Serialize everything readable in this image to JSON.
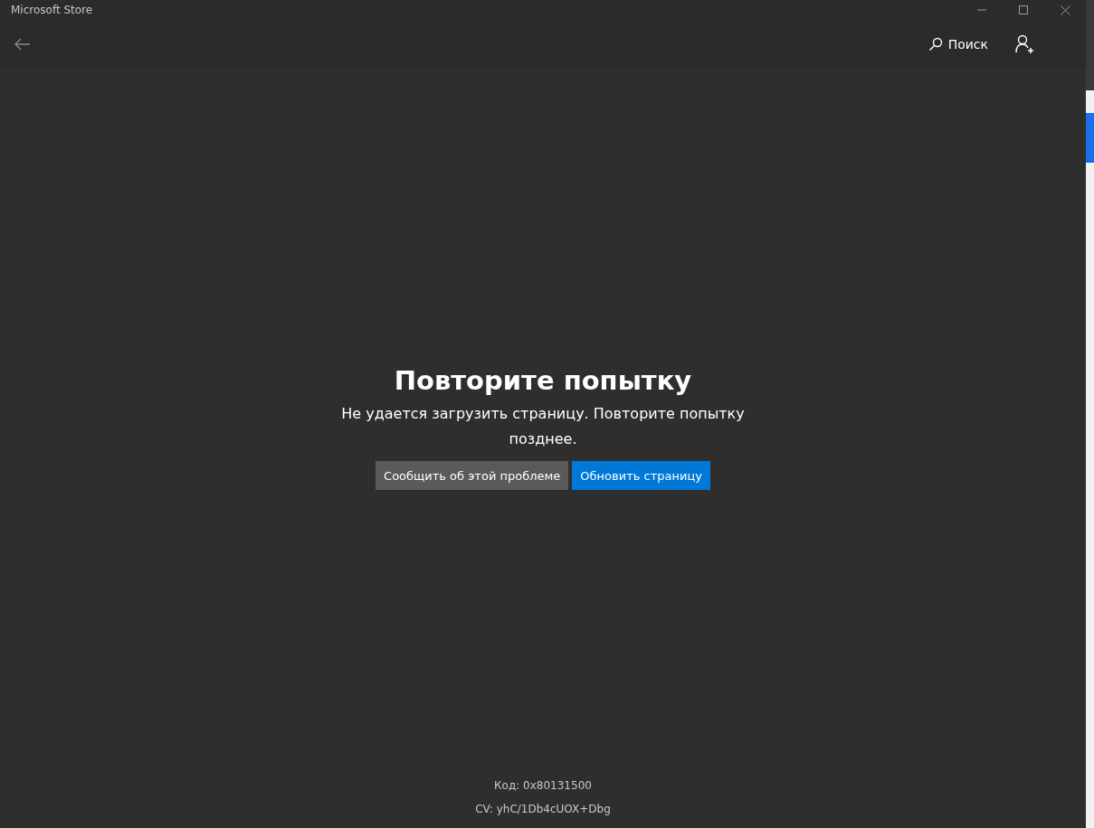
{
  "window": {
    "title": "Microsoft Store"
  },
  "header": {
    "search_label": "Поиск"
  },
  "error": {
    "title": "Повторите попытку",
    "message": "Не удается загрузить страницу. Повторите попытку позднее.",
    "buttons": [
      {
        "label": "Сообщить об этой проблеме",
        "kind": "secondary"
      },
      {
        "label": "Обновить страницу",
        "kind": "primary"
      }
    ]
  },
  "footer": {
    "code": "Код: 0x80131500",
    "cv": "CV: yhC/1Db4cUOX+Dbg"
  }
}
